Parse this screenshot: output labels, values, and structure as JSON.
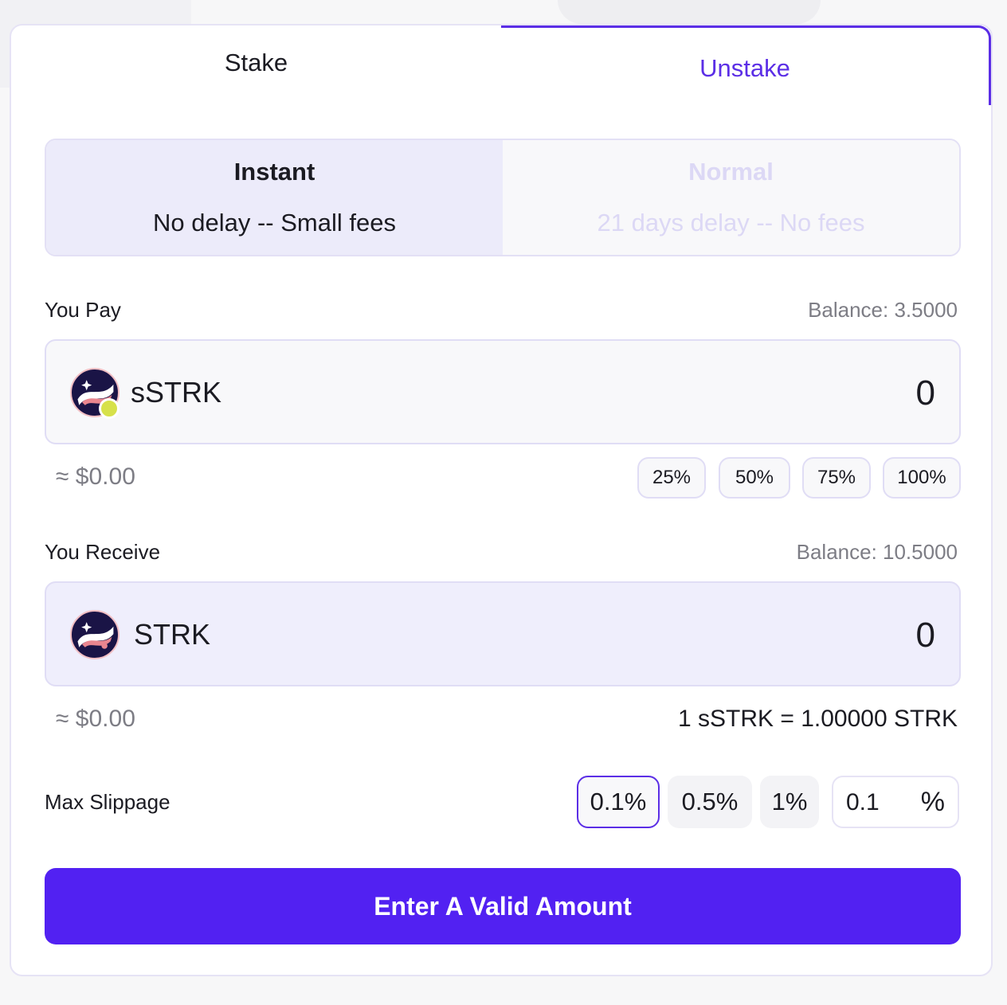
{
  "tabs": {
    "stake": "Stake",
    "unstake": "Unstake",
    "active": "unstake"
  },
  "modes": {
    "instant": {
      "title": "Instant",
      "subtitle": "No delay -- Small fees"
    },
    "normal": {
      "title": "Normal",
      "subtitle": "21 days delay -- No fees"
    },
    "selected": "instant"
  },
  "pay": {
    "label": "You Pay",
    "balance": "Balance: 3.5000",
    "token": "sSTRK",
    "amount": "0",
    "usd": "≈ $0.00",
    "percent_buttons": [
      "25%",
      "50%",
      "75%",
      "100%"
    ]
  },
  "receive": {
    "label": "You Receive",
    "balance": "Balance: 10.5000",
    "token": "STRK",
    "amount": "0",
    "usd": "≈ $0.00",
    "rate": "1 sSTRK = 1.00000 STRK"
  },
  "slippage": {
    "label": "Max Slippage",
    "options": [
      "0.1%",
      "0.5%",
      "1%"
    ],
    "selected": "0.1%",
    "custom_value": "0.1",
    "unit": "%"
  },
  "submit_label": "Enter A Valid Amount",
  "colors": {
    "accent": "#5221f2",
    "tab_accent": "#5b2ee6",
    "token_icon_bg": "#1a1446"
  },
  "icons": {
    "pay_token": "sstrk-token-icon",
    "receive_token": "strk-token-icon"
  }
}
